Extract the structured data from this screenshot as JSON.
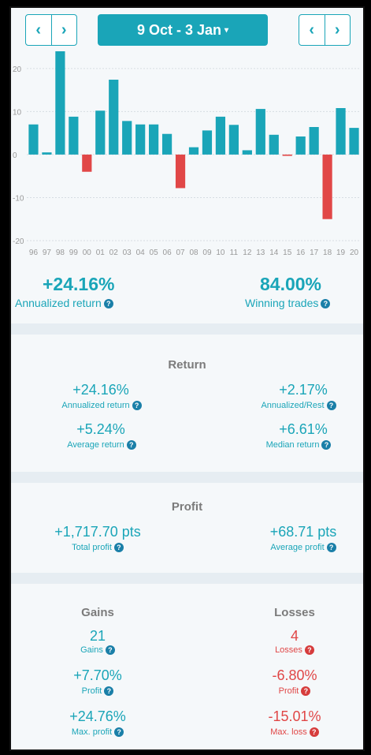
{
  "header": {
    "prev_label": "‹",
    "next_label": "›",
    "date_range": "9 Oct - 3 Jan",
    "caret": "▾"
  },
  "chart_data": {
    "type": "bar",
    "categories": [
      "96",
      "97",
      "98",
      "99",
      "00",
      "01",
      "02",
      "03",
      "04",
      "05",
      "06",
      "07",
      "08",
      "09",
      "10",
      "11",
      "12",
      "13",
      "14",
      "15",
      "16",
      "17",
      "18",
      "19",
      "20"
    ],
    "values": [
      7,
      0.5,
      24.8,
      8.8,
      -4,
      10.2,
      17.4,
      7.8,
      7,
      7,
      4.8,
      -7.8,
      1.7,
      5.6,
      8.8,
      6.9,
      1,
      10.6,
      4.6,
      -0.3,
      4.2,
      6.4,
      -15,
      10.8,
      6.2
    ],
    "ylim": [
      -20,
      24
    ],
    "yticks": [
      20,
      10,
      0,
      -10,
      -20
    ],
    "colors": {
      "positive": "#1aa5b8",
      "negative": "#e14747"
    }
  },
  "summary": {
    "annualized_value": "+24.16%",
    "annualized_label": "Annualized return",
    "winning_value": "84.00%",
    "winning_label": "Winning trades"
  },
  "return_section": {
    "title": "Return",
    "annualized_value": "+24.16%",
    "annualized_label": "Annualized return",
    "annualized_rest_value": "+2.17%",
    "annualized_rest_label": "Annualized/Rest",
    "average_value": "+5.24%",
    "average_label": "Average return",
    "median_value": "+6.61%",
    "median_label": "Median return"
  },
  "profit_section": {
    "title": "Profit",
    "total_value": "+1,717.70 pts",
    "total_label": "Total profit",
    "average_value": "+68.71 pts",
    "average_label": "Average profit"
  },
  "gains_losses": {
    "gains_title": "Gains",
    "losses_title": "Losses",
    "gains_count": "21",
    "gains_count_label": "Gains",
    "losses_count": "4",
    "losses_count_label": "Losses",
    "gains_profit": "+7.70%",
    "gains_profit_label": "Profit",
    "losses_profit": "-6.80%",
    "losses_profit_label": "Profit",
    "max_profit": "+24.76%",
    "max_profit_label": "Max. profit",
    "max_loss": "-15.01%",
    "max_loss_label": "Max. loss"
  },
  "help_icon": "?"
}
